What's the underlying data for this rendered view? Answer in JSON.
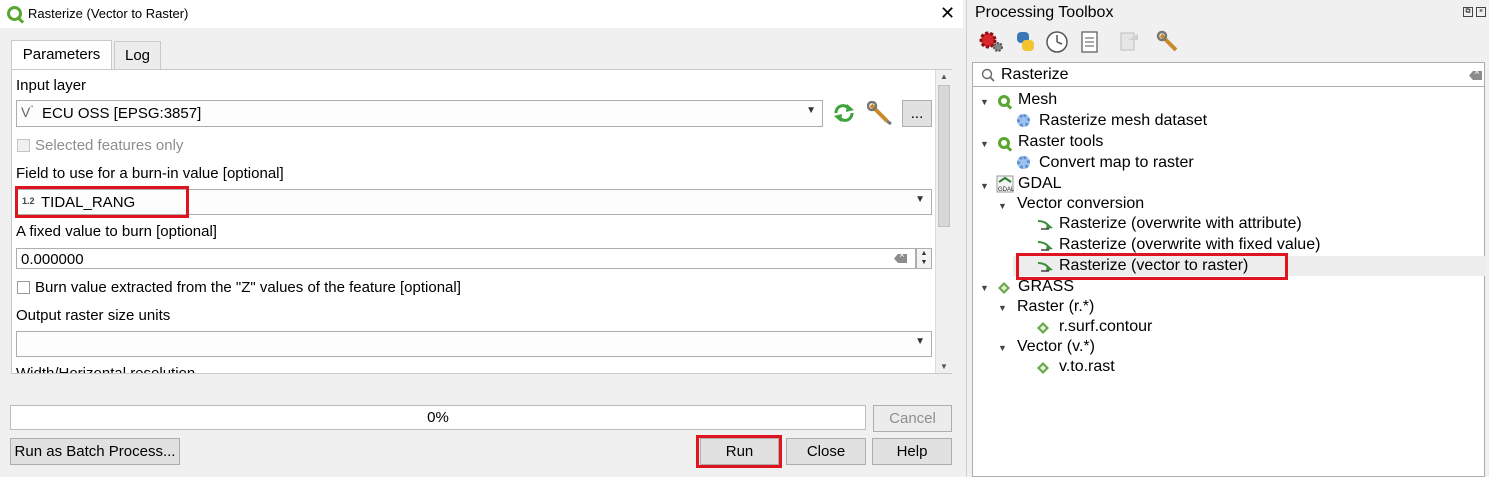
{
  "dialog": {
    "title": "Rasterize (Vector to Raster)",
    "close_glyph": "✕",
    "tabs": [
      "Parameters",
      "Log"
    ],
    "input_layer": {
      "label": "Input layer",
      "value": "ECU OSS [EPSG:3857]",
      "browse_label": "..."
    },
    "selected_features_only": "Selected features only",
    "burn_field": {
      "label": "Field to use for a burn-in value [optional]",
      "type_badge": "1.2",
      "value": "TIDAL_RANG"
    },
    "fixed_value": {
      "label": "A fixed value to burn [optional]",
      "value": "0.000000"
    },
    "burn_z_label": "Burn value extracted from the \"Z\" values of the feature [optional]",
    "output_units": {
      "label": "Output raster size units",
      "value": ""
    },
    "width_label_partial": "Width/Horizontal resolution",
    "progress": {
      "text": "0%",
      "value": 0
    },
    "buttons": {
      "cancel": "Cancel",
      "batch": "Run as Batch Process...",
      "run": "Run",
      "close": "Close",
      "help": "Help"
    },
    "highlight_color": "#e0141e"
  },
  "toolbox": {
    "title": "Processing Toolbox",
    "search_value": "Rasterize",
    "tree": [
      {
        "label": "Mesh",
        "icon": "qgis-icon",
        "level": 0
      },
      {
        "label": "Rasterize mesh dataset",
        "icon": "gear-icon",
        "level": 1
      },
      {
        "label": "Raster tools",
        "icon": "qgis-icon",
        "level": 0
      },
      {
        "label": "Convert map to raster",
        "icon": "gear-icon",
        "level": 1
      },
      {
        "label": "GDAL",
        "icon": "gdal-icon",
        "level": 0
      },
      {
        "label": "Vector conversion",
        "icon": "",
        "level": 1
      },
      {
        "label": "Rasterize (overwrite with attribute)",
        "icon": "gdal-arrow-icon",
        "level": 2
      },
      {
        "label": "Rasterize (overwrite with fixed value)",
        "icon": "gdal-arrow-icon",
        "level": 2
      },
      {
        "label": "Rasterize (vector to raster)",
        "icon": "gdal-arrow-icon",
        "level": 2,
        "selected": true
      },
      {
        "label": "GRASS",
        "icon": "grass-icon",
        "level": 0
      },
      {
        "label": "Raster (r.*)",
        "icon": "",
        "level": 1
      },
      {
        "label": "r.surf.contour",
        "icon": "grass-icon",
        "level": 2
      },
      {
        "label": "Vector (v.*)",
        "icon": "",
        "level": 1
      },
      {
        "label": "v.to.rast",
        "icon": "grass-icon",
        "level": 2
      }
    ]
  }
}
